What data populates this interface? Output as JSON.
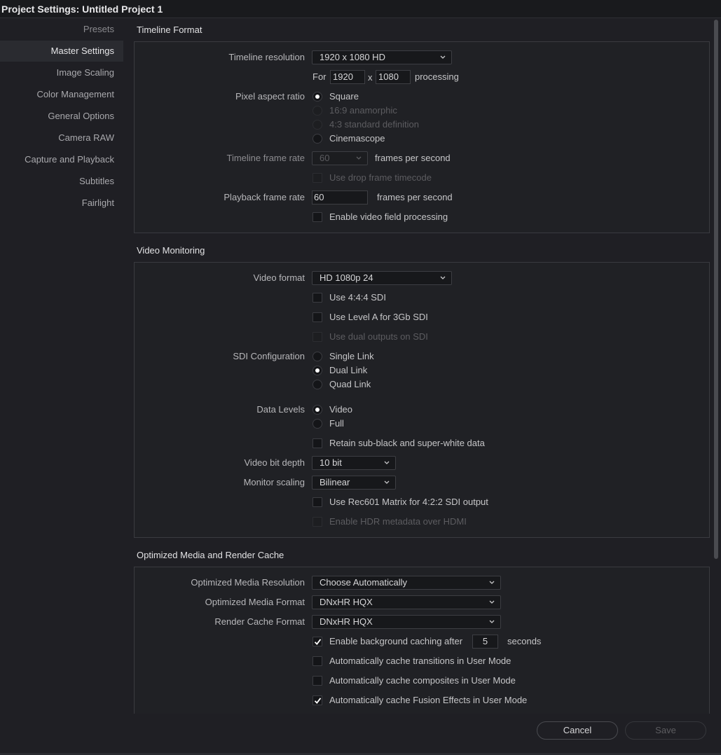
{
  "window": {
    "title": "Project Settings:  Untitled Project 1"
  },
  "sidebar": {
    "items": [
      {
        "label": "Presets"
      },
      {
        "label": "Master Settings"
      },
      {
        "label": "Image Scaling"
      },
      {
        "label": "Color Management"
      },
      {
        "label": "General Options"
      },
      {
        "label": "Camera RAW"
      },
      {
        "label": "Capture and Playback"
      },
      {
        "label": "Subtitles"
      },
      {
        "label": "Fairlight"
      }
    ]
  },
  "timeline_format": {
    "title": "Timeline Format",
    "resolution_label": "Timeline resolution",
    "resolution_value": "1920 x 1080 HD",
    "for_label": "For",
    "width_value": "1920",
    "x_label": "x",
    "height_value": "1080",
    "processing_label": "processing",
    "pixel_aspect_label": "Pixel aspect ratio",
    "aspect_options": [
      "Square",
      "16:9 anamorphic",
      "4:3 standard definition",
      "Cinemascope"
    ],
    "frame_rate_label": "Timeline frame rate",
    "frame_rate_value": "60",
    "fps_label": "frames per second",
    "drop_frame_label": "Use drop frame timecode",
    "playback_rate_label": "Playback frame rate",
    "playback_rate_value": "60",
    "playback_fps_label": "frames per second",
    "field_processing_label": "Enable video field processing"
  },
  "video_monitoring": {
    "title": "Video Monitoring",
    "video_format_label": "Video format",
    "video_format_value": "HD 1080p 24",
    "use_444_label": "Use 4:4:4 SDI",
    "level_a_label": "Use Level A for 3Gb SDI",
    "dual_outputs_label": "Use dual outputs on SDI",
    "sdi_config_label": "SDI Configuration",
    "sdi_options": [
      "Single Link",
      "Dual Link",
      "Quad Link"
    ],
    "data_levels_label": "Data Levels",
    "data_levels_options": [
      "Video",
      "Full"
    ],
    "retain_label": "Retain sub-black and super-white data",
    "bit_depth_label": "Video bit depth",
    "bit_depth_value": "10 bit",
    "monitor_scaling_label": "Monitor scaling",
    "monitor_scaling_value": "Bilinear",
    "rec601_label": "Use Rec601 Matrix for 4:2:2 SDI output",
    "hdr_label": "Enable HDR metadata over HDMI"
  },
  "optimized_media": {
    "title": "Optimized Media and Render Cache",
    "resolution_label": "Optimized Media Resolution",
    "resolution_value": "Choose Automatically",
    "format_label": "Optimized Media Format",
    "format_value": "DNxHR HQX",
    "render_cache_label": "Render Cache Format",
    "render_cache_value": "DNxHR HQX",
    "bg_caching_label": "Enable background caching after",
    "bg_caching_value": "5",
    "seconds_label": "seconds",
    "cache_transitions_label": "Automatically cache transitions in User Mode",
    "cache_composites_label": "Automatically cache composites in User Mode",
    "cache_fusion_label": "Automatically cache Fusion Effects in User Mode"
  },
  "footer": {
    "cancel_label": "Cancel",
    "save_label": "Save"
  },
  "colors": {
    "background": "#1f1f24",
    "panel": "#202125",
    "text": "#c6c6c8",
    "disabled": "#5c5c60"
  }
}
